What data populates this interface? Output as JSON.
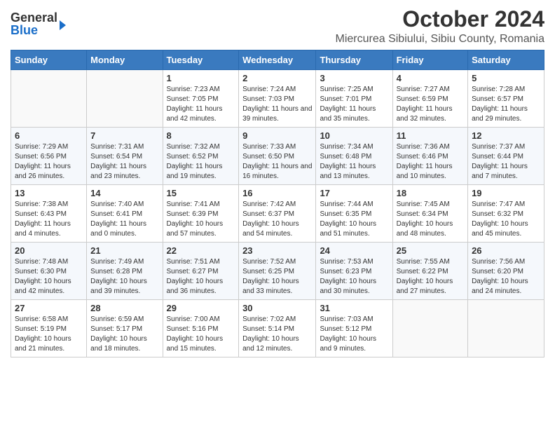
{
  "header": {
    "logo_general": "General",
    "logo_blue": "Blue",
    "month_title": "October 2024",
    "location": "Miercurea Sibiului, Sibiu County, Romania"
  },
  "weekdays": [
    "Sunday",
    "Monday",
    "Tuesday",
    "Wednesday",
    "Thursday",
    "Friday",
    "Saturday"
  ],
  "weeks": [
    [
      {
        "day": "",
        "info": ""
      },
      {
        "day": "",
        "info": ""
      },
      {
        "day": "1",
        "info": "Sunrise: 7:23 AM\nSunset: 7:05 PM\nDaylight: 11 hours and 42 minutes."
      },
      {
        "day": "2",
        "info": "Sunrise: 7:24 AM\nSunset: 7:03 PM\nDaylight: 11 hours and 39 minutes."
      },
      {
        "day": "3",
        "info": "Sunrise: 7:25 AM\nSunset: 7:01 PM\nDaylight: 11 hours and 35 minutes."
      },
      {
        "day": "4",
        "info": "Sunrise: 7:27 AM\nSunset: 6:59 PM\nDaylight: 11 hours and 32 minutes."
      },
      {
        "day": "5",
        "info": "Sunrise: 7:28 AM\nSunset: 6:57 PM\nDaylight: 11 hours and 29 minutes."
      }
    ],
    [
      {
        "day": "6",
        "info": "Sunrise: 7:29 AM\nSunset: 6:56 PM\nDaylight: 11 hours and 26 minutes."
      },
      {
        "day": "7",
        "info": "Sunrise: 7:31 AM\nSunset: 6:54 PM\nDaylight: 11 hours and 23 minutes."
      },
      {
        "day": "8",
        "info": "Sunrise: 7:32 AM\nSunset: 6:52 PM\nDaylight: 11 hours and 19 minutes."
      },
      {
        "day": "9",
        "info": "Sunrise: 7:33 AM\nSunset: 6:50 PM\nDaylight: 11 hours and 16 minutes."
      },
      {
        "day": "10",
        "info": "Sunrise: 7:34 AM\nSunset: 6:48 PM\nDaylight: 11 hours and 13 minutes."
      },
      {
        "day": "11",
        "info": "Sunrise: 7:36 AM\nSunset: 6:46 PM\nDaylight: 11 hours and 10 minutes."
      },
      {
        "day": "12",
        "info": "Sunrise: 7:37 AM\nSunset: 6:44 PM\nDaylight: 11 hours and 7 minutes."
      }
    ],
    [
      {
        "day": "13",
        "info": "Sunrise: 7:38 AM\nSunset: 6:43 PM\nDaylight: 11 hours and 4 minutes."
      },
      {
        "day": "14",
        "info": "Sunrise: 7:40 AM\nSunset: 6:41 PM\nDaylight: 11 hours and 0 minutes."
      },
      {
        "day": "15",
        "info": "Sunrise: 7:41 AM\nSunset: 6:39 PM\nDaylight: 10 hours and 57 minutes."
      },
      {
        "day": "16",
        "info": "Sunrise: 7:42 AM\nSunset: 6:37 PM\nDaylight: 10 hours and 54 minutes."
      },
      {
        "day": "17",
        "info": "Sunrise: 7:44 AM\nSunset: 6:35 PM\nDaylight: 10 hours and 51 minutes."
      },
      {
        "day": "18",
        "info": "Sunrise: 7:45 AM\nSunset: 6:34 PM\nDaylight: 10 hours and 48 minutes."
      },
      {
        "day": "19",
        "info": "Sunrise: 7:47 AM\nSunset: 6:32 PM\nDaylight: 10 hours and 45 minutes."
      }
    ],
    [
      {
        "day": "20",
        "info": "Sunrise: 7:48 AM\nSunset: 6:30 PM\nDaylight: 10 hours and 42 minutes."
      },
      {
        "day": "21",
        "info": "Sunrise: 7:49 AM\nSunset: 6:28 PM\nDaylight: 10 hours and 39 minutes."
      },
      {
        "day": "22",
        "info": "Sunrise: 7:51 AM\nSunset: 6:27 PM\nDaylight: 10 hours and 36 minutes."
      },
      {
        "day": "23",
        "info": "Sunrise: 7:52 AM\nSunset: 6:25 PM\nDaylight: 10 hours and 33 minutes."
      },
      {
        "day": "24",
        "info": "Sunrise: 7:53 AM\nSunset: 6:23 PM\nDaylight: 10 hours and 30 minutes."
      },
      {
        "day": "25",
        "info": "Sunrise: 7:55 AM\nSunset: 6:22 PM\nDaylight: 10 hours and 27 minutes."
      },
      {
        "day": "26",
        "info": "Sunrise: 7:56 AM\nSunset: 6:20 PM\nDaylight: 10 hours and 24 minutes."
      }
    ],
    [
      {
        "day": "27",
        "info": "Sunrise: 6:58 AM\nSunset: 5:19 PM\nDaylight: 10 hours and 21 minutes."
      },
      {
        "day": "28",
        "info": "Sunrise: 6:59 AM\nSunset: 5:17 PM\nDaylight: 10 hours and 18 minutes."
      },
      {
        "day": "29",
        "info": "Sunrise: 7:00 AM\nSunset: 5:16 PM\nDaylight: 10 hours and 15 minutes."
      },
      {
        "day": "30",
        "info": "Sunrise: 7:02 AM\nSunset: 5:14 PM\nDaylight: 10 hours and 12 minutes."
      },
      {
        "day": "31",
        "info": "Sunrise: 7:03 AM\nSunset: 5:12 PM\nDaylight: 10 hours and 9 minutes."
      },
      {
        "day": "",
        "info": ""
      },
      {
        "day": "",
        "info": ""
      }
    ]
  ]
}
